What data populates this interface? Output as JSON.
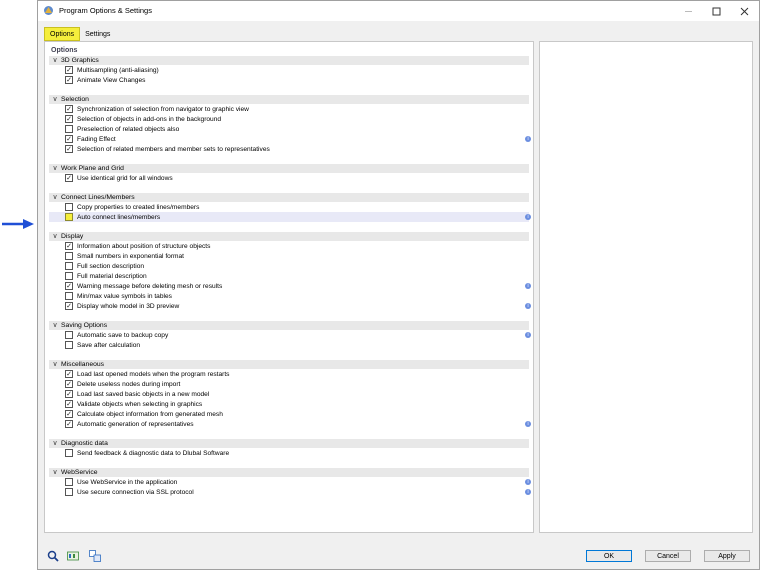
{
  "window": {
    "title": "Program Options & Settings"
  },
  "tabs": [
    {
      "label": "Options",
      "active": true
    },
    {
      "label": "Settings",
      "active": false
    }
  ],
  "panel_title": "Options",
  "sections": [
    {
      "header": "3D Graphics",
      "items": [
        {
          "label": "Multisampling (anti-aliasing)",
          "checked": true
        },
        {
          "label": "Animate View Changes",
          "checked": true
        }
      ]
    },
    {
      "header": "Selection",
      "items": [
        {
          "label": "Synchronization of selection from navigator to graphic view",
          "checked": true
        },
        {
          "label": "Selection of objects in add-ons in the background",
          "checked": true
        },
        {
          "label": "Preselection of related objects also",
          "checked": false
        },
        {
          "label": "Fading Effect",
          "checked": true,
          "info": true
        },
        {
          "label": "Selection of related members and member sets to representatives",
          "checked": true
        }
      ]
    },
    {
      "header": "Work Plane and Grid",
      "items": [
        {
          "label": "Use identical grid for all windows",
          "checked": true
        }
      ]
    },
    {
      "header": "Connect Lines/Members",
      "items": [
        {
          "label": "Copy properties to created lines/members",
          "checked": false
        },
        {
          "label": "Auto connect lines/members",
          "checked": false,
          "info": true,
          "highlight": true
        }
      ]
    },
    {
      "header": "Display",
      "items": [
        {
          "label": "Information about position of structure objects",
          "checked": true
        },
        {
          "label": "Small numbers in exponential format",
          "checked": false
        },
        {
          "label": "Full section description",
          "checked": false
        },
        {
          "label": "Full material description",
          "checked": false
        },
        {
          "label": "Warning message before deleting mesh or results",
          "checked": true,
          "info": true
        },
        {
          "label": "Min/max value symbols in tables",
          "checked": false
        },
        {
          "label": "Display whole model in 3D preview",
          "checked": true,
          "info": true
        }
      ]
    },
    {
      "header": "Saving Options",
      "items": [
        {
          "label": "Automatic save to backup copy",
          "checked": false,
          "info": true
        },
        {
          "label": "Save after calculation",
          "checked": false
        }
      ]
    },
    {
      "header": "Miscellaneous",
      "items": [
        {
          "label": "Load last opened models when the program restarts",
          "checked": true
        },
        {
          "label": "Delete useless nodes during import",
          "checked": true
        },
        {
          "label": "Load last saved basic objects in a new model",
          "checked": true
        },
        {
          "label": "Validate objects when selecting in graphics",
          "checked": true
        },
        {
          "label": "Calculate object information from generated mesh",
          "checked": true
        },
        {
          "label": "Automatic generation of representatives",
          "checked": true,
          "info": true
        }
      ]
    },
    {
      "header": "Diagnostic data",
      "items": [
        {
          "label": "Send feedback & diagnostic data to Dlubal Software",
          "checked": false
        }
      ]
    },
    {
      "header": "WebService",
      "items": [
        {
          "label": "Use WebService in the application",
          "checked": false,
          "info": true
        },
        {
          "label": "Use secure connection via SSL protocol",
          "checked": false,
          "info": true
        }
      ]
    }
  ],
  "footer": {
    "ok": "OK",
    "cancel": "Cancel",
    "apply": "Apply"
  },
  "colors": {
    "highlight_yellow": "#f5ee3c",
    "arrow_blue": "#1f4fd6",
    "info_blue": "#6b8ee0"
  }
}
